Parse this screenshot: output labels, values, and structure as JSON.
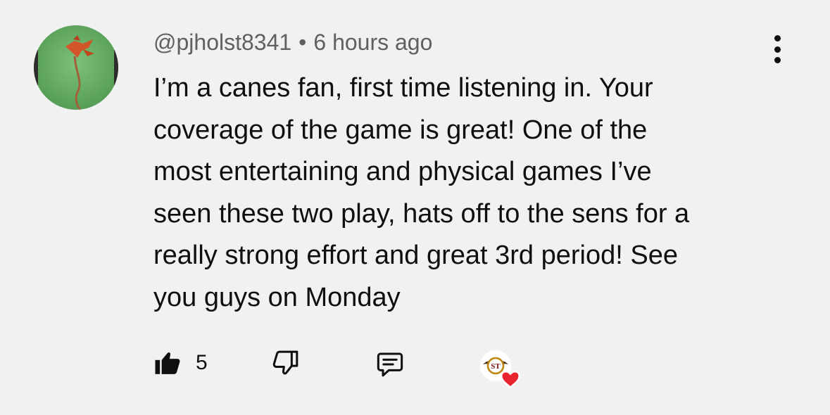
{
  "comment": {
    "author": "@pjholst8341",
    "separator": "•",
    "timestamp": "6 hours ago",
    "text": "I’m a canes fan, first time listening in. Your\ncoverage of the game is great! One of the\nmost entertaining and physical games I’ve\nseen these two play, hats off to the sens for a\nreally strong effort and great 3rd period! See\nyou guys on Monday",
    "like_count": "5",
    "creator_badge_text": "ST"
  },
  "icons": {
    "avatar": "avatar-bird-icon",
    "more": "more-vert-icon",
    "like": "thumbs-up-icon",
    "dislike": "thumbs-down-icon",
    "reply": "reply-comment-icon",
    "creator_heart": "creator-heart-icon"
  },
  "colors": {
    "background": "#f2f1f2",
    "text": "#0f0f0f",
    "meta": "#606060",
    "heart": "#e8252f",
    "avatar_bg": "#5fa760"
  }
}
